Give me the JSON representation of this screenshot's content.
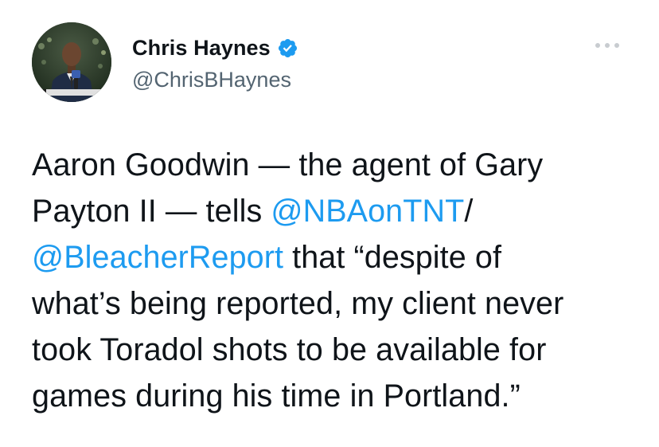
{
  "author": {
    "display_name": "Chris Haynes",
    "handle": "@ChrisBHaynes",
    "verified": true,
    "avatar_icon": "profile-photo-icon",
    "verified_icon": "verified-badge-icon"
  },
  "menu": {
    "icon": "more-options-icon"
  },
  "tweet": {
    "line1": "Aaron Goodwin — the agent of Gary",
    "line2_a": "Payton II — tells ",
    "line2_mention": "@NBAonTNT",
    "line2_b": "/",
    "line3_mention": "@BleacherReport",
    "line3_b": " that “despite of",
    "line4": "what’s being reported, my client never",
    "line5": "took Toradol shots to be available for",
    "line6": "games during his time in Portland.”"
  },
  "colors": {
    "text": "#0f1419",
    "secondary": "#536471",
    "link": "#1d9bf0",
    "verified": "#1d9bf0",
    "background": "#ffffff"
  }
}
